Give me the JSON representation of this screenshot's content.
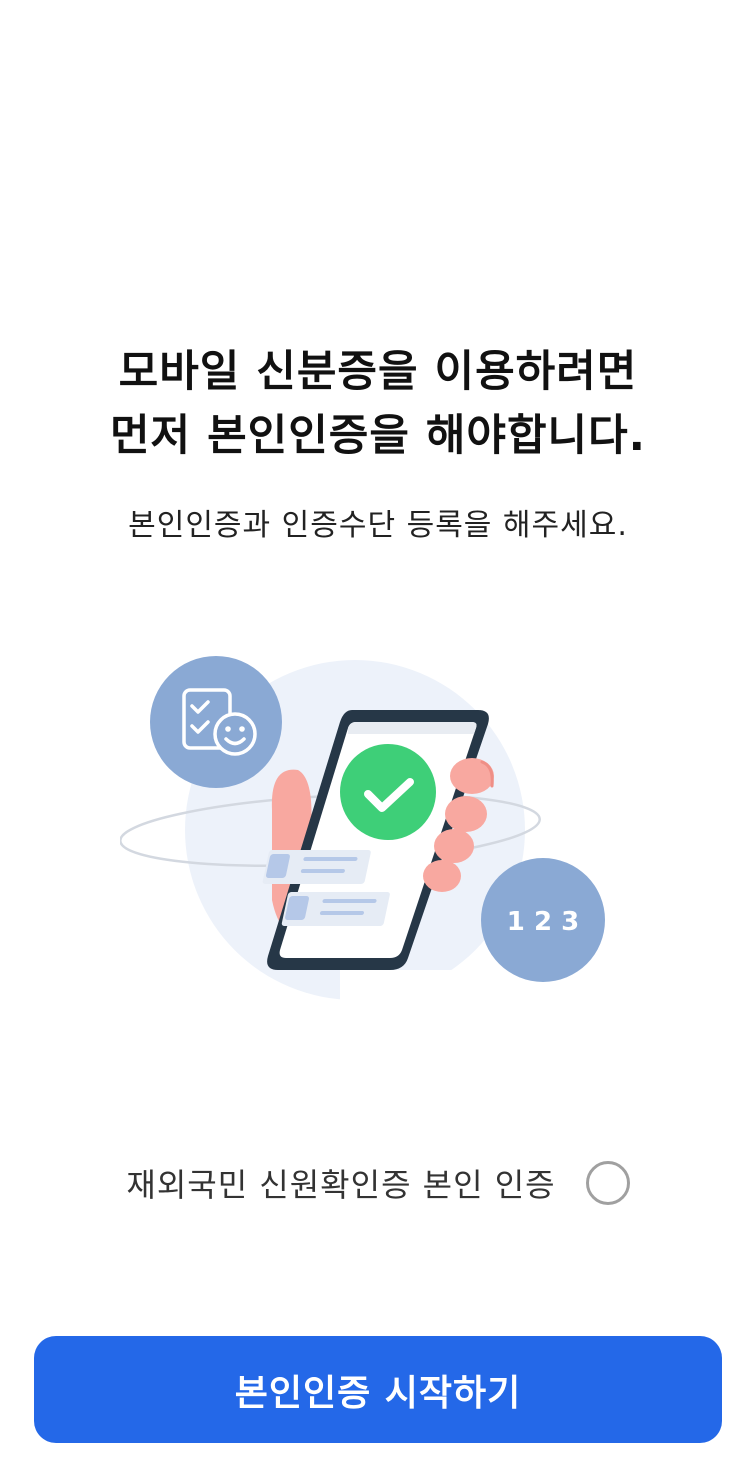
{
  "heading": {
    "line1": "모바일 신분증을 이용하려면",
    "line2": "먼저 본인인증을 해야합니다."
  },
  "subheading": "본인인증과 인증수단 등록을 해주세요.",
  "illustration": {
    "badge_number_text": "1 2 3",
    "colors": {
      "badge": "#8aa9d4",
      "check_circle": "#3ecf78",
      "hand": "#f8a8a0",
      "phone_frame": "#263747",
      "background_blob": "#edf2fa"
    }
  },
  "option": {
    "label": "재외국민 신원확인증 본인 인증",
    "checked": false
  },
  "primary_button": {
    "label": "본인인증 시작하기",
    "color": "#2468e8"
  }
}
